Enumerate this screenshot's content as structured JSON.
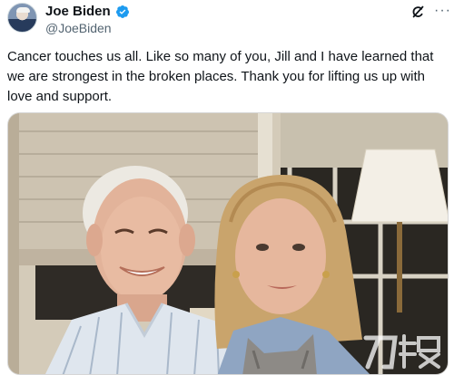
{
  "tweet": {
    "author_name": "Joe Biden",
    "author_handle": "@JoeBiden",
    "text": "Cancer touches us all. Like so many of you, Jill and I have learned that we are strongest in the broken places. Thank you for lifting us up with love and support.",
    "more_label": "···"
  },
  "icons": {
    "verified": "verified-badge-icon",
    "grok": "grok-icon",
    "more": "more-options-icon"
  },
  "photo": {
    "subject": "selfie photo"
  },
  "colors": {
    "verified_blue": "#1d9bf0",
    "handle_gray": "#536471",
    "text": "#0f1419"
  }
}
